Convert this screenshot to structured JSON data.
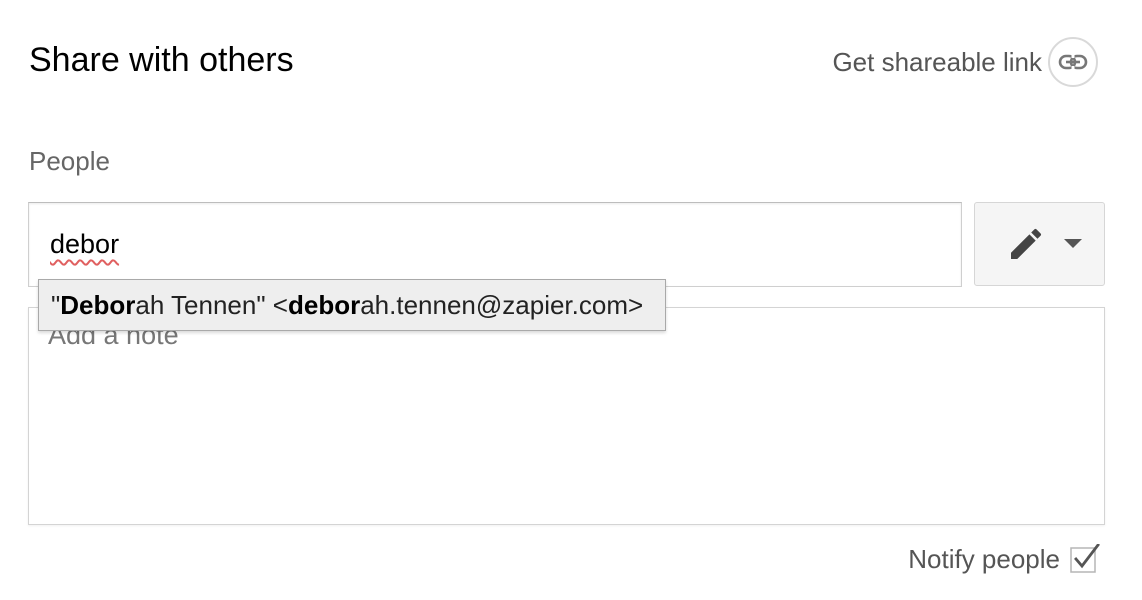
{
  "dialog": {
    "title": "Share with others",
    "get_link_label": "Get shareable link"
  },
  "people": {
    "label": "People",
    "input_value": "debor",
    "permission_icon": "pencil-icon"
  },
  "suggestion": {
    "quote_open": "\"",
    "name_match": "Debor",
    "name_rest": "ah Tennen",
    "quote_close": "\" <",
    "email_match": "debor",
    "email_rest": "ah.tennen@zapier.com>"
  },
  "note": {
    "placeholder": "Add a note"
  },
  "notify": {
    "label": "Notify people",
    "checked": true
  }
}
